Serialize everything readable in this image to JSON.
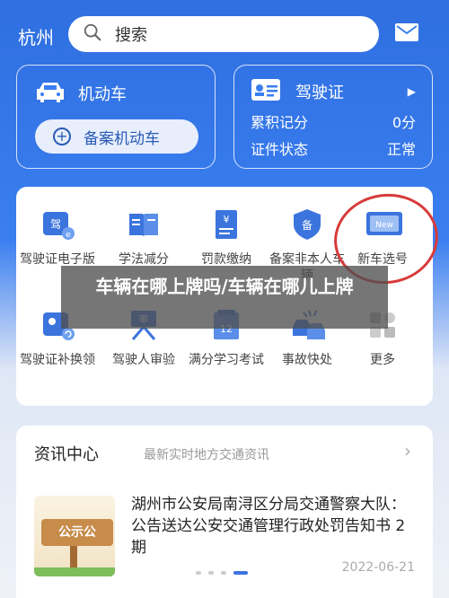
{
  "header": {
    "city": "杭州",
    "search_placeholder": "搜索",
    "icons": [
      "search-icon",
      "mail-icon"
    ]
  },
  "vehicle_card": {
    "title": "机动车",
    "register_button": "备案机动车"
  },
  "license_card": {
    "title": "驾驶证",
    "rows": [
      {
        "label": "累积记分",
        "value": "0分"
      },
      {
        "label": "证件状态",
        "value": "正常"
      }
    ]
  },
  "services": [
    {
      "label": "驾驶证电子版",
      "icon": "license-id-icon"
    },
    {
      "label": "学法减分",
      "icon": "book-icon"
    },
    {
      "label": "罚款缴纳",
      "icon": "fine-payment-icon"
    },
    {
      "label": "备案非本人车辆",
      "icon": "register-shield-icon"
    },
    {
      "label": "新车选号",
      "icon": "new-plate-icon"
    },
    {
      "label": "驾驶证补换领",
      "icon": "license-renew-icon"
    },
    {
      "label": "驾驶人审验",
      "icon": "driver-review-icon"
    },
    {
      "label": "满分学习考试",
      "icon": "exam-icon"
    },
    {
      "label": "事故快处",
      "icon": "accident-icon"
    },
    {
      "label": "更多",
      "icon": "more-grid-icon"
    }
  ],
  "overlay_text": "车辆在哪上牌吗/车辆在哪儿上牌",
  "news": {
    "header": "资讯中心",
    "subheader": "最新实时地方交通资讯",
    "thumbnail_text": "公示公",
    "title": "湖州市公安局南浔区分局交通警察大队：公告送达公安交通管理行政处罚告知书 2期",
    "date": "2022-06-21"
  },
  "colors": {
    "brand_blue": "#3a7ef0",
    "highlight_red": "#d83a3a"
  }
}
